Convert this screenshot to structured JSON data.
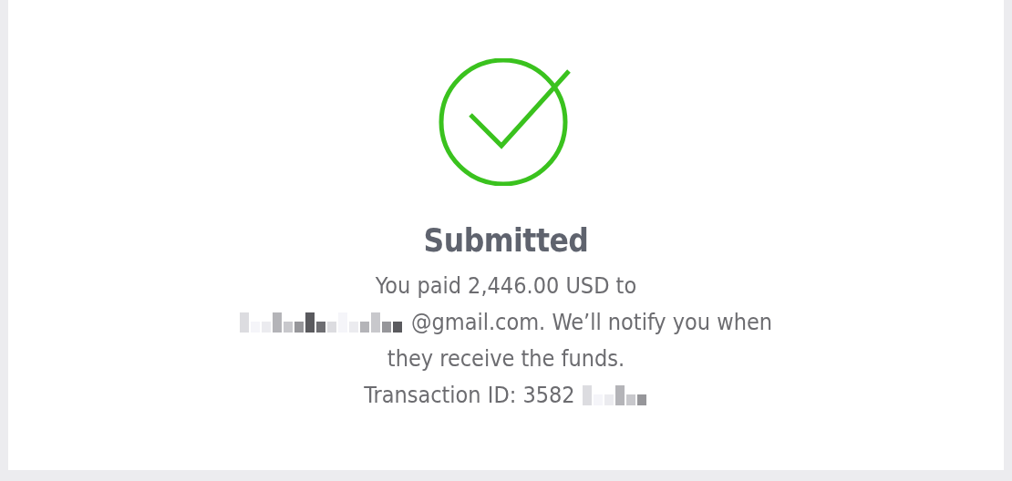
{
  "status": {
    "kind": "success"
  },
  "title": "Submitted",
  "message_lines": [
    {
      "parts": [
        {
          "kind": "text",
          "text": "You paid 2,446.00 USD to"
        }
      ]
    },
    {
      "parts": [
        {
          "kind": "redacted"
        },
        {
          "kind": "text",
          "text": "@gmail.com. We’ll notify you when"
        }
      ]
    },
    {
      "parts": [
        {
          "kind": "text",
          "text": "they receive the funds."
        }
      ]
    },
    {
      "parts": [
        {
          "kind": "text",
          "text": "Transaction ID: 3582"
        },
        {
          "kind": "redacted"
        }
      ]
    }
  ]
}
